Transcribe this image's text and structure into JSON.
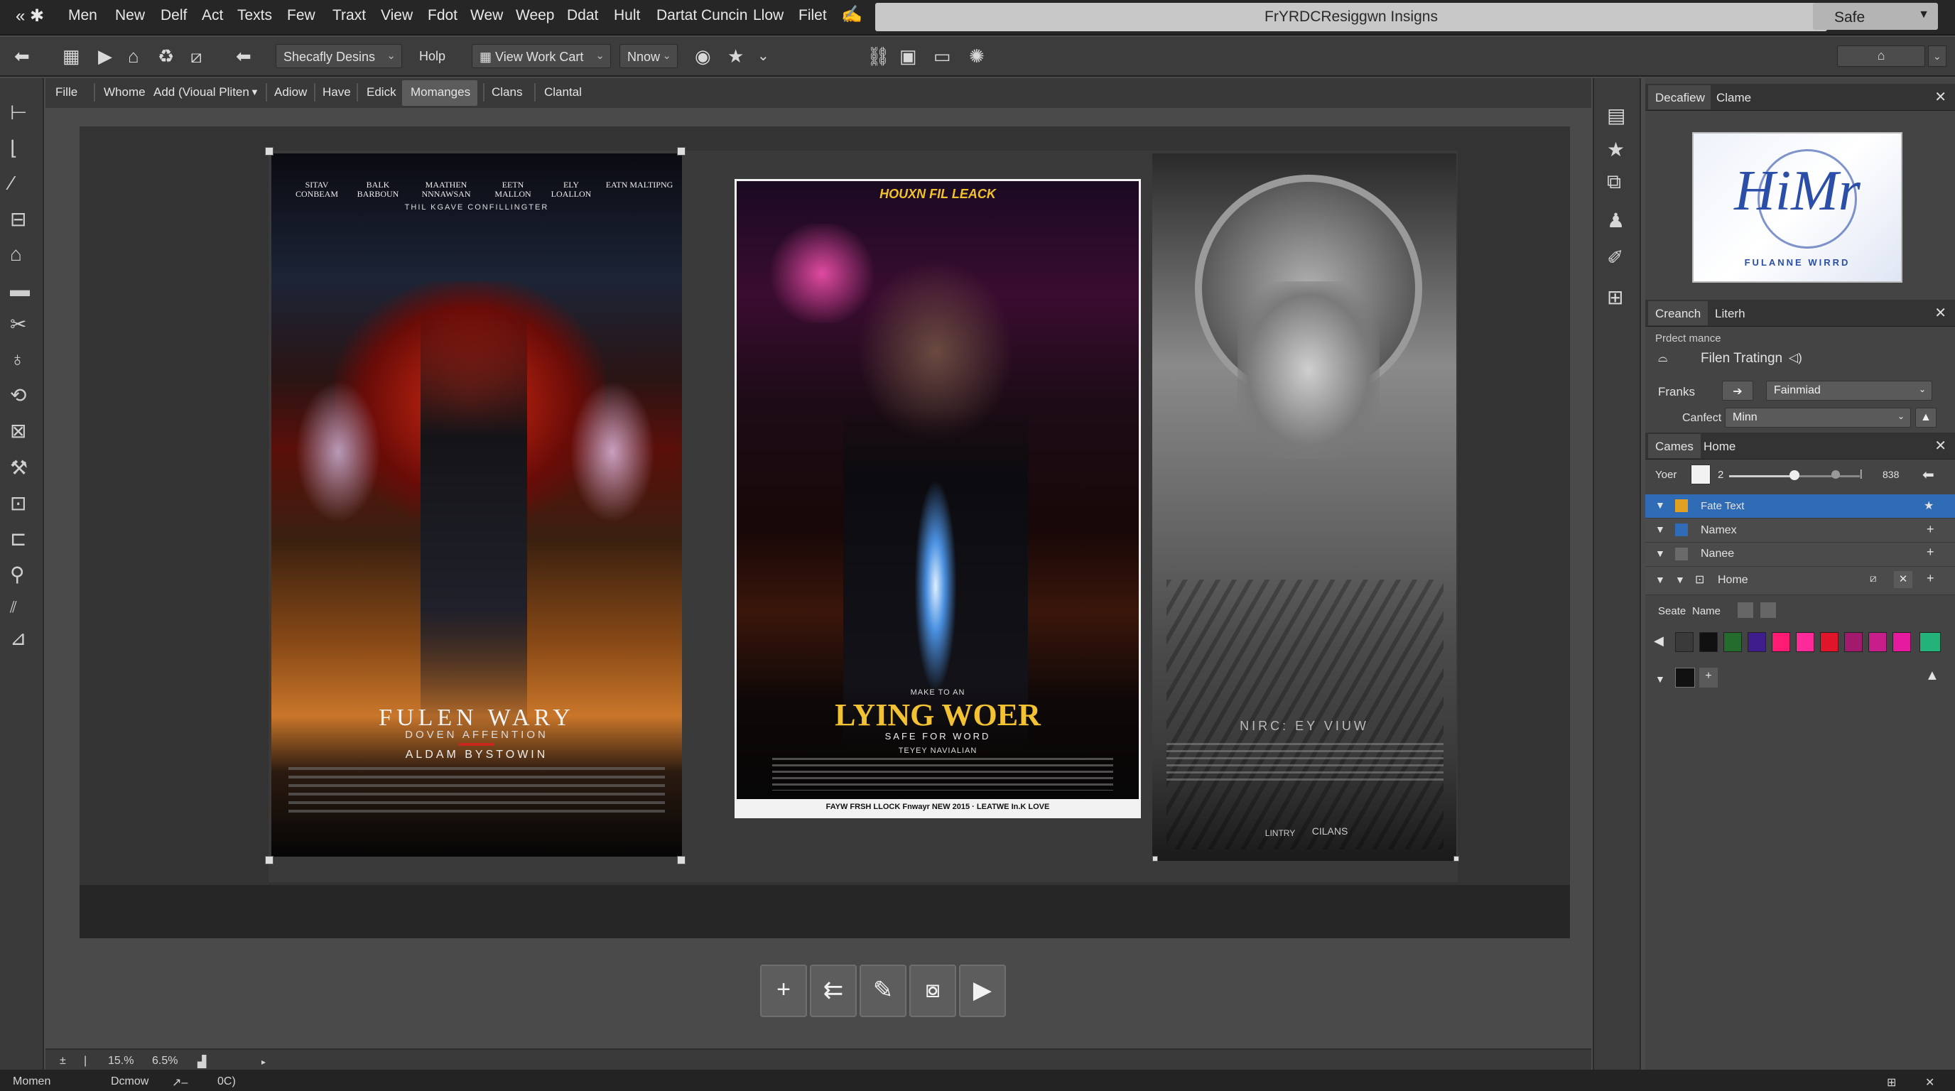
{
  "menu": {
    "items": [
      "Men",
      "New",
      "Delf",
      "Act",
      "Texts",
      "Few",
      "Traxt",
      "View",
      "Fdot",
      "Wew",
      "Weep",
      "Ddat",
      "Hult",
      "Dartat Cuncin",
      "Llow",
      "Filet"
    ],
    "window_title": "FrYRDCResiggwn Insigns",
    "safe_label": "Safe"
  },
  "toolbar": {
    "dropdown1": "Shecafly Desins",
    "help": "Holp",
    "dropdown2": "View Work Cart",
    "dropdown3": "Nnow"
  },
  "tabs": {
    "items": [
      "Fille",
      "Whome",
      "Add (Vioual Pliten",
      "Adiow",
      "Have",
      "Edick",
      "Momanges",
      "Clans",
      "Clantal"
    ],
    "active": "Momanges"
  },
  "posters": {
    "p1": {
      "credits": [
        "SITAV CONBEAM",
        "BALK BARBOUN",
        "MAATHEN NNNAWSAN",
        "EETN MALLON",
        "ELY LOALLON",
        "EATN MALTIPNG"
      ],
      "tagline": "THIL KGAVE CONFILLINGTER",
      "title": "FULEN WARY",
      "subtitle": "DOVEN AFFENTION",
      "director": "ALDAM BYSTOWIN"
    },
    "p2": {
      "top": "HOUXN FIL LEACK",
      "small": "MAKE TO AN",
      "title": "LYING WOER",
      "subtitle": "SAFE FOR WORD",
      "credit": "TEYEY NAVIALIAN",
      "footer": "FAYW FRSH LLOCK Fnwayr NEW 2015 · LEATWE In.K LOVE"
    },
    "p3": {
      "title": "NIRC: EY VIUW",
      "bottom_left": "LINTRY",
      "bottom_right": "CILANS"
    }
  },
  "statusbar": {
    "zoom1": "15.%",
    "zoom2": "6.5%"
  },
  "footer": {
    "left": "Momen",
    "mid": "Dcmow",
    "extra": "0C)"
  },
  "panel_top": {
    "tabs": [
      "Decafiew",
      "Clame"
    ],
    "logo_text": "HiMr",
    "logo_caption": "FULANNE WIRRD"
  },
  "panel_mid": {
    "tabs": [
      "Creanch",
      "Literh"
    ],
    "heading": "Prdect mance",
    "item": "Filen Tratingn",
    "franks_label": "Franks",
    "franks_value": "Fainmiad",
    "confect_label": "Canfect",
    "confect_value": "Minn"
  },
  "panel_layers": {
    "tabs": [
      "Cames",
      "Home"
    ],
    "your_label": "Yoer",
    "slider_value": "2",
    "slider_max": "838",
    "slider_level": 0.5,
    "layers": [
      "Fate Text",
      "Namex",
      "Nanee",
      "Home"
    ],
    "search_label": "Seate",
    "name_label": "Name"
  },
  "swatches": [
    "#3a3a3a",
    "#111111",
    "#246c2e",
    "#3e1e8c",
    "#ff1a74",
    "#ff2a9a",
    "#e0142a",
    "#a21a6e",
    "#c81e8c",
    "#e61a9e",
    "#22b27a"
  ],
  "colors": {
    "accent": "#2f6cb5"
  }
}
